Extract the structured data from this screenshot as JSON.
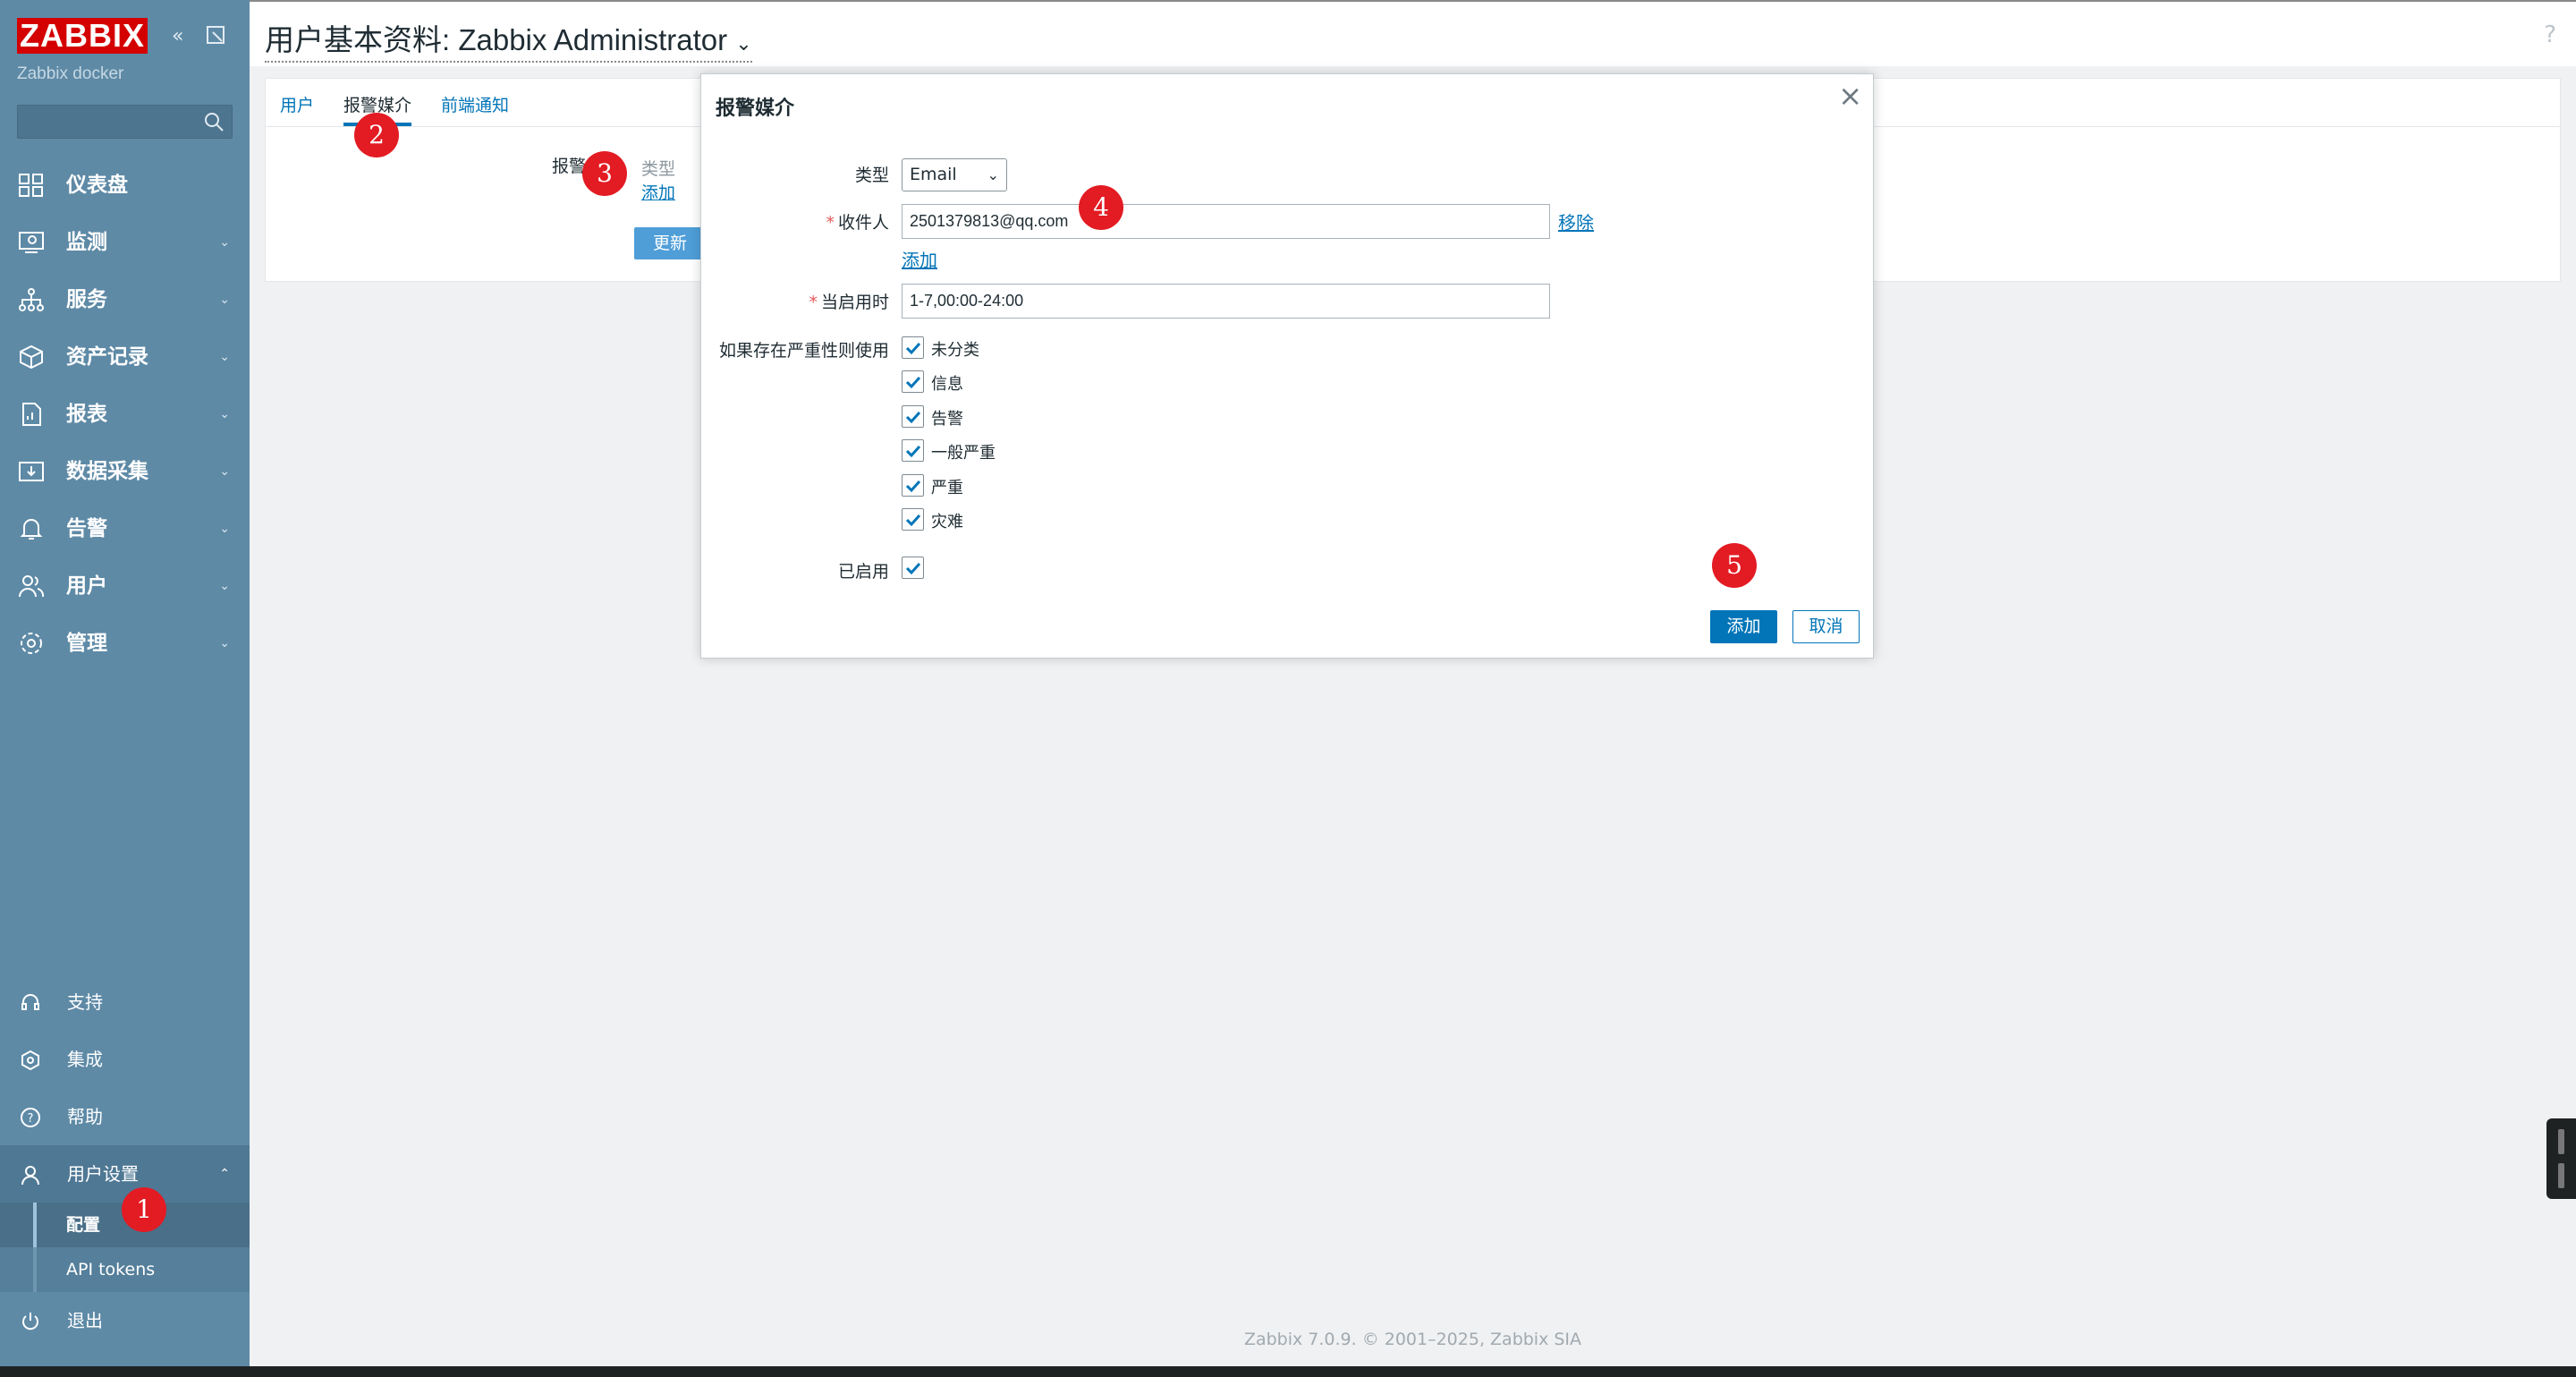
{
  "sidebar": {
    "logo": "ZABBIX",
    "server_name": "Zabbix docker",
    "search_placeholder": "",
    "menu": [
      {
        "label": "仪表盘",
        "icon": "dashboard-icon",
        "has_chevron": false
      },
      {
        "label": "监测",
        "icon": "monitoring-icon",
        "has_chevron": true
      },
      {
        "label": "服务",
        "icon": "services-icon",
        "has_chevron": true
      },
      {
        "label": "资产记录",
        "icon": "inventory-icon",
        "has_chevron": true
      },
      {
        "label": "报表",
        "icon": "reports-icon",
        "has_chevron": true
      },
      {
        "label": "数据采集",
        "icon": "data-collection-icon",
        "has_chevron": true
      },
      {
        "label": "告警",
        "icon": "alerts-icon",
        "has_chevron": true
      },
      {
        "label": "用户",
        "icon": "users-icon",
        "has_chevron": true
      },
      {
        "label": "管理",
        "icon": "administration-icon",
        "has_chevron": true
      }
    ],
    "bottom": {
      "support": "支持",
      "integrations": "集成",
      "help": "帮助",
      "user_settings": "用户设置",
      "profile": "配置",
      "api_tokens": "API tokens",
      "signout": "退出"
    }
  },
  "header": {
    "title": "用户基本资料: Zabbix Administrator",
    "help": "?"
  },
  "tabs": [
    {
      "label": "用户",
      "active": false
    },
    {
      "label": "报警媒介",
      "active": true
    },
    {
      "label": "前端通知",
      "active": false
    }
  ],
  "media_tab": {
    "field_label": "报警媒介",
    "col_type": "类型",
    "add_link": "添加",
    "update_button": "更新"
  },
  "dialog": {
    "title": "报警媒介",
    "close": "×",
    "type_label": "类型",
    "type_value": "Email",
    "sendto_label": "收件人",
    "sendto_value": "2501379813@qq.com",
    "remove_link": "移除",
    "add_link": "添加",
    "when_active_label": "当启用时",
    "when_active_value": "1-7,00:00-24:00",
    "severity_label": "如果存在严重性则使用",
    "severities": [
      {
        "label": "未分类",
        "checked": true
      },
      {
        "label": "信息",
        "checked": true
      },
      {
        "label": "告警",
        "checked": true
      },
      {
        "label": "一般严重",
        "checked": true
      },
      {
        "label": "严重",
        "checked": true
      },
      {
        "label": "灾难",
        "checked": true
      }
    ],
    "enabled_label": "已启用",
    "enabled": true,
    "add_button": "添加",
    "cancel_button": "取消"
  },
  "badges": [
    "1",
    "2",
    "3",
    "4",
    "5"
  ],
  "footer": "Zabbix 7.0.9. © 2001–2025, Zabbix SIA",
  "colors": {
    "sidebar": "#5e8aa6",
    "logo": "#d40000",
    "primary": "#0275b8",
    "badge": "#e31b23"
  }
}
